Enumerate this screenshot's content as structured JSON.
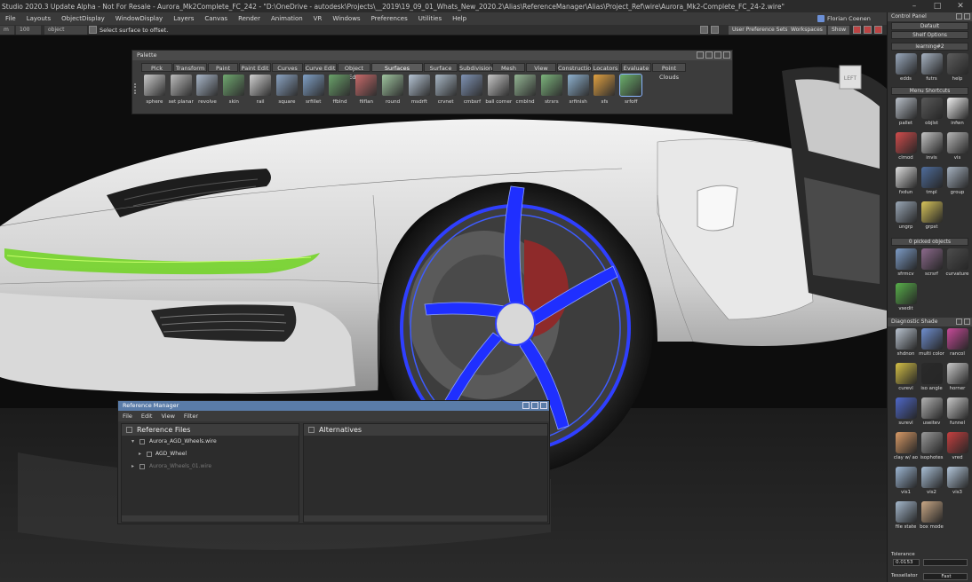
{
  "window": {
    "title": "Studio 2020.3 Update Alpha - Not For Resale - Aurora_Mk2Complete_FC_242 - \"D:\\OneDrive - autodesk\\Projects\\__2019\\19_09_01_Whats_New_2020.2\\Alias\\ReferenceManager\\Alias\\Project_Ref\\wire\\Aurora_Mk2-Complete_FC_24-2.wire\"",
    "controls": [
      "–",
      "□",
      "✕"
    ]
  },
  "menubar": {
    "items": [
      "File",
      "Layouts",
      "ObjectDisplay",
      "WindowDisplay",
      "Layers",
      "Canvas",
      "Render",
      "Animation",
      "VR",
      "Windows",
      "Preferences",
      "Utilities",
      "Help"
    ],
    "user": "Florian Coenen"
  },
  "promptbar": {
    "field_left": "m",
    "field_mid": "100",
    "field_object": "object",
    "prompt": "Select surface to offset.",
    "user_pref_sets": "User Preference Sets",
    "workspaces": "Workspaces",
    "show": "Show"
  },
  "viewport": {
    "view_cube_label": "LEFT"
  },
  "palette": {
    "title": "Palette",
    "tabs": [
      "Pick",
      "Transform",
      "Paint",
      "Paint Edit",
      "Curves",
      "Curve Edit",
      "Object Edit",
      "Surfaces",
      "Surface Edit",
      "Subdivision",
      "Mesh",
      "View",
      "Construction",
      "Locators",
      "Evaluate",
      "Point Clouds"
    ],
    "active_tab": "Surfaces",
    "tools": [
      {
        "label": "sphere",
        "color": "#c9c9c9"
      },
      {
        "label": "set planar",
        "color": "#bcbcbc"
      },
      {
        "label": "revolve",
        "color": "#a9b7c9"
      },
      {
        "label": "skin",
        "color": "#6fa86f"
      },
      {
        "label": "rail",
        "color": "#d0d0d0"
      },
      {
        "label": "square",
        "color": "#8aa3c2"
      },
      {
        "label": "srfillet",
        "color": "#7fa0c6"
      },
      {
        "label": "ffblnd",
        "color": "#6aa36a"
      },
      {
        "label": "filflan",
        "color": "#c96a6a"
      },
      {
        "label": "round",
        "color": "#9fc49f"
      },
      {
        "label": "msdrft",
        "color": "#b5c4d4"
      },
      {
        "label": "crvnet",
        "color": "#a8b7c5"
      },
      {
        "label": "cmbsrf",
        "color": "#7f93b5"
      },
      {
        "label": "ball corner",
        "color": "#c6c6c6"
      },
      {
        "label": "crnblnd",
        "color": "#93b593"
      },
      {
        "label": "strsrs",
        "color": "#7cb57c"
      },
      {
        "label": "srfinish",
        "color": "#8eb1cf"
      },
      {
        "label": "sfs",
        "color": "#e0a040"
      },
      {
        "label": "srfoff",
        "color": "#6bb06b"
      }
    ],
    "selected_tool": "srfoff"
  },
  "reference_manager": {
    "title": "Reference Manager",
    "menu": [
      "File",
      "Edit",
      "View",
      "Filter"
    ],
    "left_header": "Reference Files",
    "right_header": "Alternatives",
    "rows": [
      {
        "label": "Aurora_AGD_Wheels.wire",
        "expander": "▾",
        "dim": false
      },
      {
        "label": "AGD_Wheel",
        "expander": "▸",
        "dim": false
      },
      {
        "label": "Aurora_Wheels_01.wire",
        "expander": "▸",
        "dim": true
      }
    ]
  },
  "control_panel": {
    "title": "Control Panel",
    "default_label": "Default",
    "shelf_options": "Shelf Options",
    "shelf_tab": "learning#2",
    "row1": [
      {
        "label": "edds",
        "color": "#9aa9bd"
      },
      {
        "label": "futrs",
        "color": "#a7b3c2"
      },
      {
        "label": "help",
        "color": "#5d5d5d"
      }
    ],
    "menu_shortcuts": "Menu Shortcuts",
    "row2": [
      {
        "label": "pallet",
        "color": "#b9c0c9"
      },
      {
        "label": "objlst",
        "color": "#5a5a5a"
      },
      {
        "label": "infwn",
        "color": "#f0f0f0"
      },
      {
        "label": "clmod",
        "color": "#d24c4c"
      },
      {
        "label": "invis",
        "color": "#c4c4c4"
      },
      {
        "label": "vis",
        "color": "#b6b6b6"
      },
      {
        "label": "fxdun",
        "color": "#dedede"
      },
      {
        "label": "tmpl",
        "color": "#4f6d9c"
      },
      {
        "label": "group",
        "color": "#a6b2c0"
      },
      {
        "label": "ungrp",
        "color": "#9aa7b6"
      },
      {
        "label": "grpst",
        "color": "#d8c45a"
      }
    ],
    "picked_objects": "0 picked objects",
    "row3": [
      {
        "label": "sfrmcv",
        "color": "#7d9cc6"
      },
      {
        "label": "scrsrf",
        "color": "#8d6a8d"
      },
      {
        "label": "curvature",
        "color": "#4d4d4d"
      },
      {
        "label": "vsedit",
        "color": "#58b04a"
      }
    ],
    "diagnostic_shade": "Diagnostic Shade",
    "row4": [
      {
        "label": "shdnon",
        "color": "#b9c3cf"
      },
      {
        "label": "multi color",
        "color": "#6f8fd0"
      },
      {
        "label": "rancol",
        "color": "#c84b9a"
      },
      {
        "label": "curevl",
        "color": "#d4c046"
      },
      {
        "label": "iso angle",
        "color": "#2a2a2a"
      },
      {
        "label": "horner",
        "color": "#c9c9c9"
      },
      {
        "label": "surevl",
        "color": "#4f68c9"
      },
      {
        "label": "useitev",
        "color": "#b3b3b3"
      },
      {
        "label": "funnel",
        "color": "#c8c8c8"
      },
      {
        "label": "clay w/ ao",
        "color": "#d89a66"
      },
      {
        "label": "isophotes",
        "color": "#9a9a9a"
      },
      {
        "label": "vred",
        "color": "#c64040"
      },
      {
        "label": "vis1",
        "color": "#9db6d2"
      },
      {
        "label": "vis2",
        "color": "#a9bfd6"
      },
      {
        "label": "vis3",
        "color": "#b3c6da"
      },
      {
        "label": "file state",
        "color": "#a5b8cc"
      },
      {
        "label": "box mode",
        "color": "#c9a886"
      }
    ],
    "tolerance_label": "Tolerance",
    "tolerance_value": "0.0153",
    "tessellator_label": "Tessellator",
    "tessellator_value": "Fast"
  }
}
